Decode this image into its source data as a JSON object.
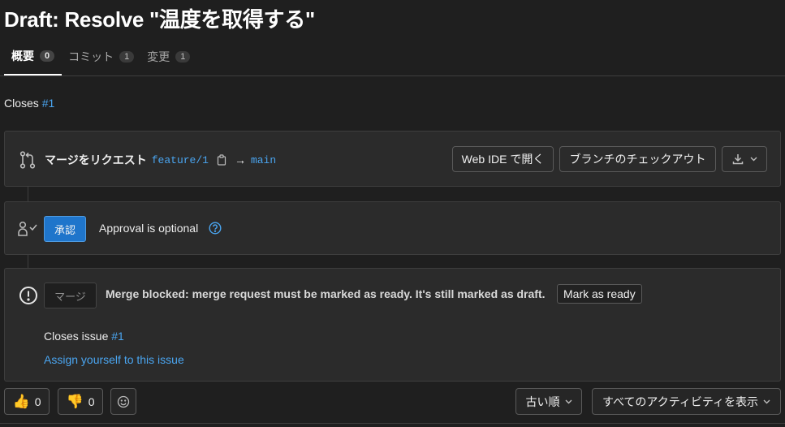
{
  "page": {
    "title": "Draft: Resolve \"温度を取得する\""
  },
  "tabs": [
    {
      "label": "概要",
      "count": "0",
      "active": true
    },
    {
      "label": "コミット",
      "count": "1",
      "active": false
    },
    {
      "label": "変更",
      "count": "1",
      "active": false
    }
  ],
  "description": {
    "text": "Closes",
    "issue_ref": "#1"
  },
  "branch_card": {
    "label": "マージをリクエスト",
    "source_branch": "feature/1",
    "arrow": "→",
    "target_branch": "main",
    "web_ide_button": "Web IDE で開く",
    "checkout_button": "ブランチのチェックアウト",
    "icons": [
      "merge-request-icon",
      "copy-icon",
      "download-icon",
      "chevron-down-icon"
    ]
  },
  "approval_card": {
    "approve_button": "承認",
    "status_text": "Approval is optional",
    "icons": [
      "approval-icon",
      "help-icon"
    ]
  },
  "merge_card": {
    "merge_button": "マージ",
    "blocked_text": "Merge blocked: merge request must be marked as ready. It's still marked as draft.",
    "mark_ready_button": "Mark as ready",
    "closes_issue_text": "Closes issue",
    "closes_issue_ref": "#1",
    "assign_link": "Assign yourself to this issue",
    "icons": [
      "warning-icon"
    ]
  },
  "reactions": {
    "thumbs_up_count": "0",
    "thumbs_down_count": "0",
    "icons": [
      "thumbs-up-icon",
      "thumbs-down-icon",
      "emoji-icon"
    ]
  },
  "activity": {
    "sort_label": "古い順",
    "filter_label": "すべてのアクティビティを表示"
  },
  "colors": {
    "background": "#1f1f1f",
    "card": "#2b2b2b",
    "link": "#4aa5f0",
    "primary_button": "#1f75cb"
  }
}
